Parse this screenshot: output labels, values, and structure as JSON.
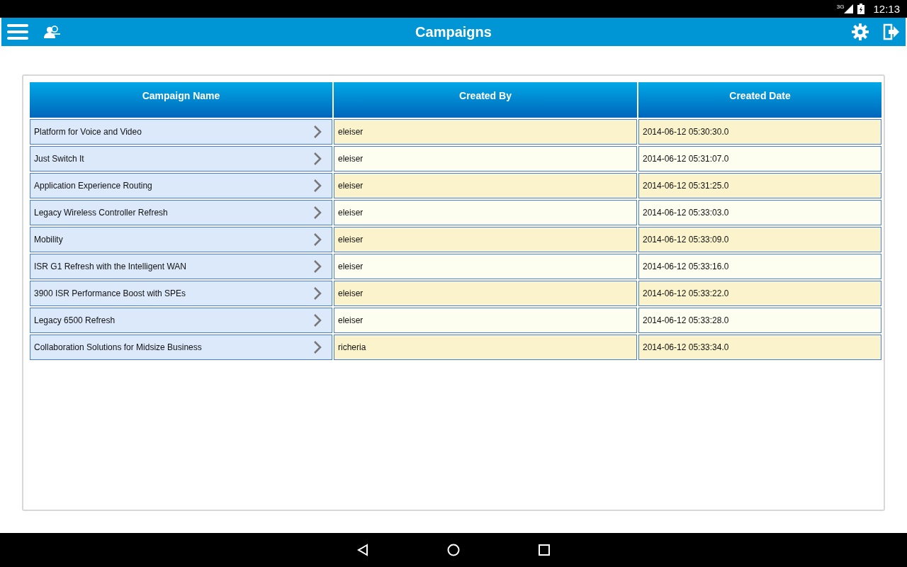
{
  "status_bar": {
    "network": "3G",
    "time": "12:13"
  },
  "app_bar": {
    "title": "Campaigns"
  },
  "table": {
    "columns": [
      "Campaign Name",
      "Created By",
      "Created Date"
    ],
    "rows": [
      {
        "name": "Platform for Voice and Video",
        "created_by": "eleiser",
        "created_date": "2014-06-12 05:30:30.0"
      },
      {
        "name": "Just Switch It",
        "created_by": "eleiser",
        "created_date": "2014-06-12 05:31:07.0"
      },
      {
        "name": "Application Experience Routing",
        "created_by": "eleiser",
        "created_date": "2014-06-12 05:31:25.0"
      },
      {
        "name": "Legacy Wireless Controller Refresh",
        "created_by": "eleiser",
        "created_date": "2014-06-12 05:33:03.0"
      },
      {
        "name": "Mobility",
        "created_by": "eleiser",
        "created_date": "2014-06-12 05:33:09.0"
      },
      {
        "name": "ISR G1 Refresh with the Intelligent WAN",
        "created_by": "eleiser",
        "created_date": "2014-06-12 05:33:16.0"
      },
      {
        "name": "3900 ISR Performance Boost with SPEs",
        "created_by": "eleiser",
        "created_date": "2014-06-12 05:33:22.0"
      },
      {
        "name": "Legacy 6500 Refresh",
        "created_by": "eleiser",
        "created_date": "2014-06-12 05:33:28.0"
      },
      {
        "name": "Collaboration Solutions for Midsize Business",
        "created_by": "richeria",
        "created_date": "2014-06-12 05:33:34.0"
      }
    ]
  }
}
